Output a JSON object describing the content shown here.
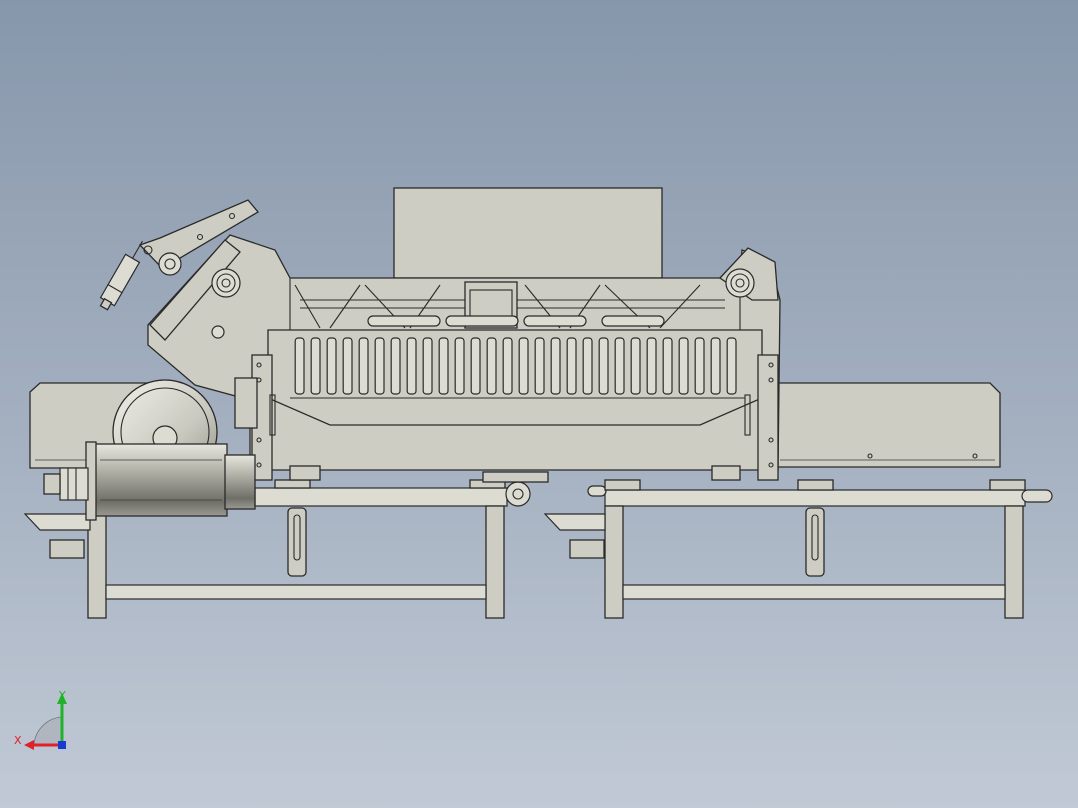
{
  "triad": {
    "x_label": "X",
    "y_label": "Y",
    "x_color": "#e0202a",
    "y_color": "#1fb22a",
    "z_color": "#1a3ad6"
  },
  "colors": {
    "part_fill": "#cdcdc3",
    "edge": "#2a2a2a",
    "motor_shade": "#8e8e86"
  }
}
